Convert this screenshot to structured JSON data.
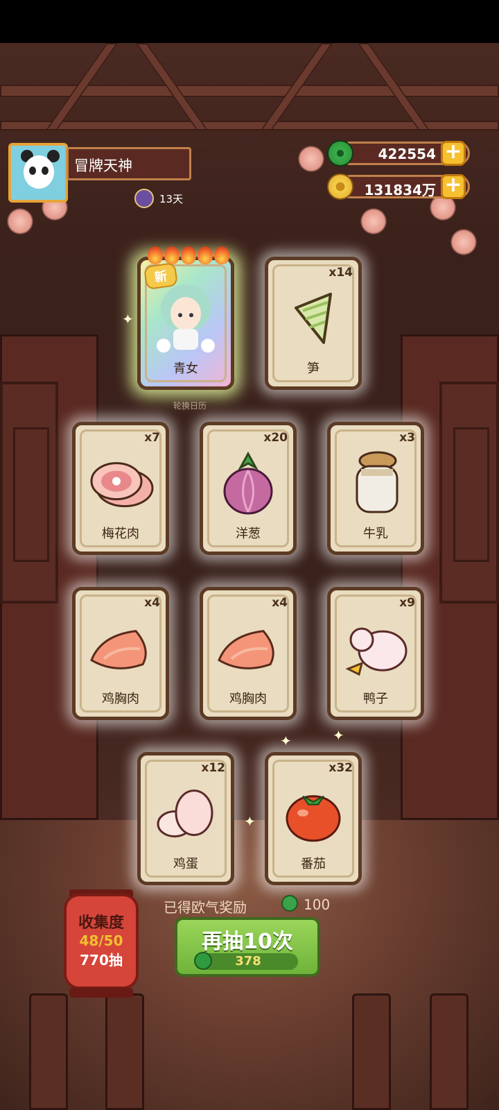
{
  "profile": {
    "name": "冒牌天神",
    "days": "13天"
  },
  "currency": {
    "jade": "422554",
    "coins": "131834万"
  },
  "calendar_label": "轮换日历",
  "new_tag": "新",
  "cards": [
    {
      "label": "青女",
      "count": "",
      "icon": "character-qingnv-icon"
    },
    {
      "label": "笋",
      "count": "x14",
      "icon": "bamboo-shoot-icon"
    },
    {
      "label": "梅花肉",
      "count": "x7",
      "icon": "pork-icon"
    },
    {
      "label": "洋葱",
      "count": "x20",
      "icon": "onion-icon"
    },
    {
      "label": "牛乳",
      "count": "x3",
      "icon": "milk-jar-icon"
    },
    {
      "label": "鸡胸肉",
      "count": "x4",
      "icon": "chicken-breast-icon"
    },
    {
      "label": "鸡胸肉",
      "count": "x4",
      "icon": "chicken-breast-icon"
    },
    {
      "label": "鸭子",
      "count": "x9",
      "icon": "duck-icon"
    },
    {
      "label": "鸡蛋",
      "count": "x12",
      "icon": "egg-icon"
    },
    {
      "label": "番茄",
      "count": "x32",
      "icon": "tomato-icon"
    }
  ],
  "collection": {
    "title": "收集度",
    "progress": "48/50",
    "draws": "770抽"
  },
  "reward": {
    "text": "已得欧气奖励",
    "value": "100"
  },
  "draw_button": {
    "label": "再抽10次",
    "cost": "378"
  },
  "colors": {
    "accent_green": "#6fb33a",
    "gold": "#f6c030",
    "lantern_red": "#d6453a"
  }
}
